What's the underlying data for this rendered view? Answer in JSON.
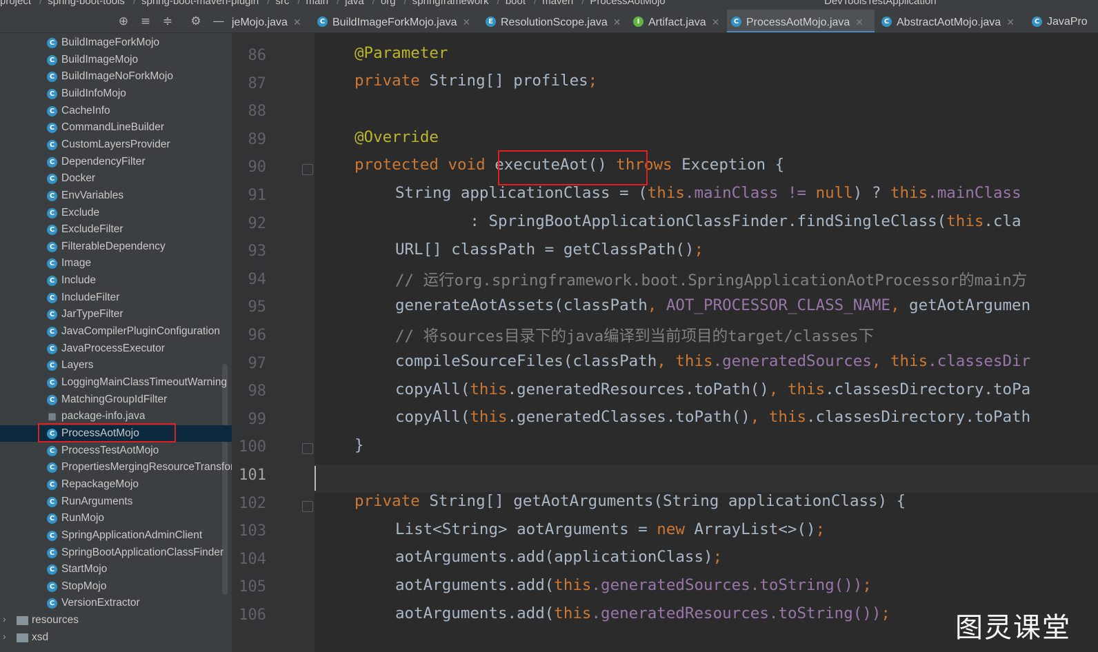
{
  "breadcrumb": {
    "items": [
      "project",
      "spring-boot-tools",
      "spring-boot-maven-plugin",
      "src",
      "main",
      "java",
      "org",
      "springframework",
      "boot",
      "maven",
      "ProcessAotMojo"
    ],
    "run_config": "DevToolsTestApplication"
  },
  "tabs": [
    {
      "label": "jeMojo.java",
      "icon": "class-icon"
    },
    {
      "label": "BuildImageForkMojo.java",
      "icon": "class-icon"
    },
    {
      "label": "ResolutionScope.java",
      "icon": "enum-icon"
    },
    {
      "label": "Artifact.java",
      "icon": "interface-icon"
    },
    {
      "label": "ProcessAotMojo.java",
      "icon": "class-icon",
      "active": true
    },
    {
      "label": "AbstractAotMojo.java",
      "icon": "class-icon"
    },
    {
      "label": "JavaPro",
      "icon": "class-icon"
    }
  ],
  "tree": {
    "items": [
      "BuildImageForkMojo",
      "BuildImageMojo",
      "BuildImageNoForkMojo",
      "BuildInfoMojo",
      "CacheInfo",
      "CommandLineBuilder",
      "CustomLayersProvider",
      "DependencyFilter",
      "Docker",
      "EnvVariables",
      "Exclude",
      "ExcludeFilter",
      "FilterableDependency",
      "Image",
      "Include",
      "IncludeFilter",
      "JarTypeFilter",
      "JavaCompilerPluginConfiguration",
      "JavaProcessExecutor",
      "Layers",
      "LoggingMainClassTimeoutWarning",
      "MatchingGroupIdFilter",
      "package-info.java",
      "ProcessAotMojo",
      "ProcessTestAotMojo",
      "PropertiesMergingResourceTransformer",
      "RepackageMojo",
      "RunArguments",
      "RunMojo",
      "SpringApplicationAdminClient",
      "SpringBootApplicationClassFinder",
      "StartMojo",
      "StopMojo",
      "VersionExtractor"
    ],
    "selected": "ProcessAotMojo",
    "folders": [
      "resources",
      "xsd"
    ]
  },
  "editor": {
    "current_line": "101",
    "lines": [
      {
        "n": "86"
      },
      {
        "n": "87"
      },
      {
        "n": "88"
      },
      {
        "n": "89"
      },
      {
        "n": "90"
      },
      {
        "n": "91"
      },
      {
        "n": "92"
      },
      {
        "n": "93"
      },
      {
        "n": "94"
      },
      {
        "n": "95"
      },
      {
        "n": "96"
      },
      {
        "n": "97"
      },
      {
        "n": "98"
      },
      {
        "n": "99"
      },
      {
        "n": "100"
      },
      {
        "n": "101"
      },
      {
        "n": "102"
      },
      {
        "n": "103"
      },
      {
        "n": "104"
      },
      {
        "n": "105"
      },
      {
        "n": "106"
      }
    ],
    "code": {
      "l86": "@Parameter",
      "l87_kw": "private",
      "l87_rest": " String[] profiles",
      "l87_semi": ";",
      "l89": "@Override",
      "l90_kw": "protected void",
      "l90_name": " executeAot()",
      "l90_kw2": " throws",
      "l90_rest": " Exception {",
      "l91_a": "String applicationClass = (",
      "l91_this1": "this",
      "l91_b": ".mainClass != ",
      "l91_null": "null",
      "l91_c": ") ? ",
      "l91_this2": "this",
      "l91_d": ".mainClass",
      "l92_a": "        : SpringBootApplicationClassFinder.findSingleClass(",
      "l92_this": "this",
      "l92_b": ".cla",
      "l93": "URL[] classPath = getClassPath()",
      "l93_semi": ";",
      "l94": "// 运行org.springframework.boot.SpringApplicationAotProcessor的main方",
      "l95_a": "generateAotAssets(classPath",
      "l95_c1": ",",
      "l95_b": " AOT_PROCESSOR_CLASS_NAME",
      "l95_c2": ",",
      "l95_c": " getAotArgumen",
      "l96": "// 将sources目录下的java编译到当前项目的target/classes下",
      "l97_a": "compileSourceFiles(classPath",
      "l97_c1": ", ",
      "l97_this1": "this",
      "l97_b": ".generatedSources",
      "l97_c2": ", ",
      "l97_this2": "this",
      "l97_c": ".classesDir",
      "l98_a": "copyAll(",
      "l98_this1": "this",
      "l98_b": ".generatedResources.toPath()",
      "l98_c1": ", ",
      "l98_this2": "this",
      "l98_c": ".classesDirectory.toPa",
      "l99_a": "copyAll(",
      "l99_this1": "this",
      "l99_b": ".generatedClasses.toPath()",
      "l99_c1": ", ",
      "l99_this2": "this",
      "l99_c": ".classesDirectory.toPath",
      "l100": "}",
      "l102_kw": "private",
      "l102_rest": " String[] getAotArguments(String applicationClass) {",
      "l103_a": "List<String> aotArguments = ",
      "l103_new": "new",
      "l103_b": " ArrayList<>()",
      "l103_semi": ";",
      "l104_a": "aotArguments.add(applicationClass)",
      "l104_semi": ";",
      "l105_a": "aotArguments.add(",
      "l105_this": "this",
      "l105_b": ".generatedSources.toString())",
      "l105_semi": ";",
      "l106_a": "aotArguments.add(",
      "l106_this": "this",
      "l106_b": ".generatedResources.toString())",
      "l106_semi": ";"
    }
  },
  "watermark": "图灵课堂",
  "colors": {
    "keyword": "#cc7832",
    "annotation": "#bbb529",
    "field": "#9876aa",
    "comment": "#808080",
    "default": "#a9b7c6",
    "highlight_box": "#e02020"
  }
}
